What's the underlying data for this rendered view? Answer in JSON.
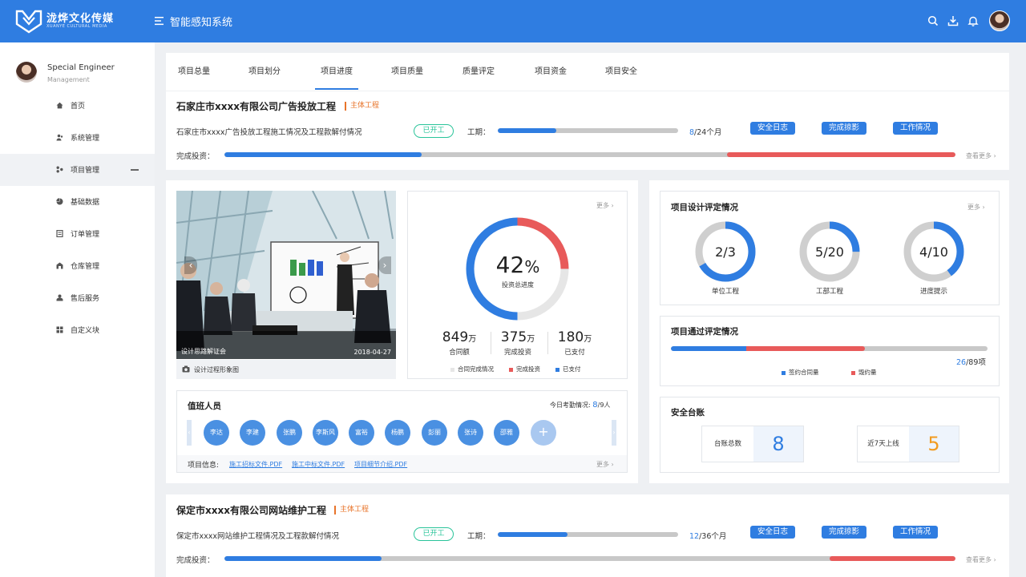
{
  "header": {
    "brand": "泷烨文化传媒",
    "brand_sub": "XUANYE CULTURAL MEDIA",
    "system_title": "智能感知系统",
    "icons": [
      "search-icon",
      "download-icon",
      "bell-icon"
    ],
    "colors": {
      "primary": "#2f7de1",
      "danger": "#e85a5a",
      "success": "#2ac49a",
      "accent": "#e8742a"
    }
  },
  "sidebar": {
    "user_name": "Special Engineer",
    "user_role": "Management",
    "items": [
      {
        "label": "首页",
        "icon": "home-icon"
      },
      {
        "label": "系统管理",
        "icon": "users-icon"
      },
      {
        "label": "项目管理",
        "icon": "project-icon",
        "active": true
      },
      {
        "label": "基础数据",
        "icon": "pie-icon"
      },
      {
        "label": "订单管理",
        "icon": "order-icon"
      },
      {
        "label": "仓库管理",
        "icon": "warehouse-icon"
      },
      {
        "label": "售后服务",
        "icon": "service-icon"
      },
      {
        "label": "自定义块",
        "icon": "grid-icon"
      }
    ]
  },
  "tabs": [
    {
      "label": "项目总量"
    },
    {
      "label": "项目划分"
    },
    {
      "label": "项目进度",
      "active": true
    },
    {
      "label": "项目质量"
    },
    {
      "label": "质量评定"
    },
    {
      "label": "项目资金"
    },
    {
      "label": "项目安全"
    }
  ],
  "projects": [
    {
      "title": "石家庄市xxxx有限公司广告投放工程",
      "tag": "主体工程",
      "desc": "石家庄市xxxx广告投放工程施工情况及工程款解付情况",
      "status": "已开工",
      "period_label": "工期：",
      "period_done": "8",
      "period_total": "/24个月",
      "period_fraction": 0.333,
      "buttons": [
        "安全日志",
        "完成掠影",
        "工作情况"
      ],
      "invest_label": "完成投资：",
      "invest_blue": 0.27,
      "invest_red": 0.31,
      "more": "查看更多"
    },
    {
      "title": "保定市xxxx有限公司网站维护工程",
      "tag": "主体工程",
      "desc": "保定市xxxx网站维护工程情况及工程款解付情况",
      "status": "已开工",
      "period_label": "工期：",
      "period_done": "12",
      "period_total": "/36个月",
      "period_fraction": 0.333,
      "buttons": [
        "安全日志",
        "完成掠影",
        "工作情况"
      ],
      "invest_label": "完成投资：",
      "invest_blue": 0.21,
      "invest_red": 0.17,
      "more": "查看更多"
    }
  ],
  "photo": {
    "caption": "设计思路解证会",
    "date": "2018-04-27",
    "footer": "设计过程形象图"
  },
  "invest": {
    "more": "更多",
    "pct": "42",
    "pct_unit": "%",
    "center_label": "投资总进度",
    "stats": [
      {
        "value": "849",
        "unit": "万",
        "label": "合同额"
      },
      {
        "value": "375",
        "unit": "万",
        "label": "完成投资"
      },
      {
        "value": "180",
        "unit": "万",
        "label": "已支付"
      }
    ],
    "legend": [
      "合同完成情况",
      "完成投资",
      "已支付"
    ]
  },
  "duty": {
    "title": "值班人员",
    "count_label": "今日考勤情况:",
    "count_present": "8",
    "count_total": "/9人",
    "people": [
      "李达",
      "李建",
      "张鹏",
      "李斯风",
      "富裕",
      "杨鹏",
      "彭丽",
      "张诗",
      "邵雅"
    ],
    "add": "+",
    "files_label": "项目信息:",
    "files": [
      "施工招标文件.PDF",
      "施工中标文件.PDF",
      "项目细节介绍.PDF"
    ],
    "more": "更多"
  },
  "design_eval": {
    "title": "项目设计评定情况",
    "more": "更多",
    "rings": [
      {
        "value": "2/3",
        "label": "单位工程",
        "fraction": 0.667
      },
      {
        "value": "5/20",
        "label": "工部工程",
        "fraction": 0.25
      },
      {
        "value": "4/10",
        "label": "进度提示",
        "fraction": 0.4
      }
    ]
  },
  "pass_eval": {
    "title": "项目通过评定情况",
    "done": "26",
    "total": "/89项",
    "blue_fraction": 0.27,
    "red_fraction": 0.29,
    "legend": [
      "签约合同量",
      "毁约量"
    ]
  },
  "safety": {
    "title": "安全台账",
    "items": [
      {
        "label": "台账总数",
        "value": "8",
        "color": "#2f7de1"
      },
      {
        "label": "近7天上线",
        "value": "5",
        "color": "#f29b1f"
      }
    ]
  }
}
